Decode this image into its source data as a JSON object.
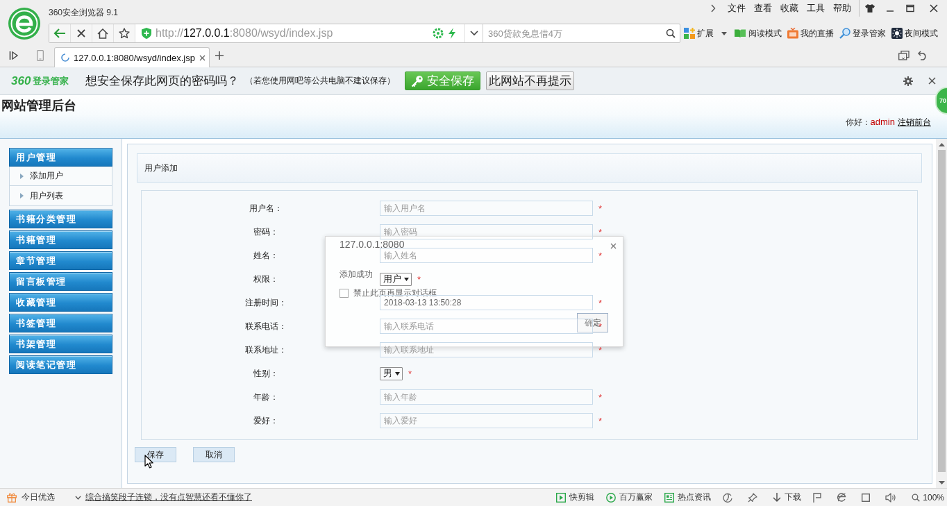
{
  "browser": {
    "title": "360安全浏览器 9.1",
    "menu": [
      "文件",
      "查看",
      "收藏",
      "工具",
      "帮助"
    ],
    "url": {
      "scheme": "http://",
      "host": "127.0.0.1",
      "rest": ":8080/wsyd/index.jsp"
    },
    "search": {
      "placeholder": "360贷款免息借4万"
    },
    "toolbar": [
      "扩展",
      "阅读模式",
      "我的直播",
      "登录管家",
      "夜间模式"
    ],
    "tabs": [
      {
        "label": "127.0.0.1:8080/wsyd/index.jsp",
        "selected": true
      }
    ]
  },
  "password_bar": {
    "brand": "360",
    "product": "登录管家",
    "question": "想安全保存此网页的密码吗？",
    "note": "（若您使用网吧等公共电脑不建议保存）",
    "buttons": [
      "安全保存",
      "此网站不再提示"
    ]
  },
  "speed_ball": "70",
  "header": {
    "title": "网站管理后台",
    "greeting": "你好：",
    "user": "admin",
    "link": "注销前台"
  },
  "sidebar": {
    "groups": [
      {
        "label": "用户管理",
        "children": [
          {
            "label": "添加用户"
          },
          {
            "label": "用户列表"
          }
        ]
      },
      {
        "label": "书籍分类管理"
      },
      {
        "label": "书籍管理"
      },
      {
        "label": "章节管理"
      },
      {
        "label": "留言板管理"
      },
      {
        "label": "收藏管理"
      },
      {
        "label": "书签管理"
      },
      {
        "label": "书架管理"
      },
      {
        "label": "阅读笔记管理"
      }
    ]
  },
  "panel": {
    "title": "用户添加",
    "fields": [
      {
        "label": "用户名：",
        "kind": "text",
        "placeholder": "输入用户名",
        "required_mark": "*"
      },
      {
        "label": "密码：",
        "kind": "text",
        "placeholder": "输入密码",
        "required_mark": "*"
      },
      {
        "label": "姓名：",
        "kind": "text",
        "placeholder": "输入姓名",
        "required_mark": "*"
      },
      {
        "label": "权限：",
        "kind": "select",
        "value": "用户",
        "required_mark": "*"
      },
      {
        "label": "注册时间：",
        "kind": "text",
        "value": "2018-03-13 13:50:28",
        "required_mark": "*"
      },
      {
        "label": "联系电话：",
        "kind": "text",
        "placeholder": "输入联系电话",
        "required_mark": "*"
      },
      {
        "label": "联系地址：",
        "kind": "text",
        "placeholder": "输入联系地址",
        "required_mark": "*"
      },
      {
        "label": "性别：",
        "kind": "select",
        "value": "男",
        "required_mark": "*"
      },
      {
        "label": "年龄：",
        "kind": "text",
        "placeholder": "输入年龄",
        "required_mark": "*"
      },
      {
        "label": "爱好：",
        "kind": "text",
        "placeholder": "输入爱好",
        "required_mark": "*"
      }
    ],
    "buttons": [
      "保存",
      "取消"
    ]
  },
  "dialog": {
    "title": "127.0.0.1:8080",
    "message": "添加成功",
    "checkbox": {
      "label": "禁止此页再显示对话框",
      "checked": false
    },
    "button": "确定"
  },
  "status_bar": {
    "promo": "今日优选",
    "news": "综合搞笑段子连锁，没有点智慧还看不懂你了",
    "items": [
      "快剪辑",
      "百万赢家",
      "热点资讯",
      "下载"
    ],
    "zoom": "100%"
  }
}
